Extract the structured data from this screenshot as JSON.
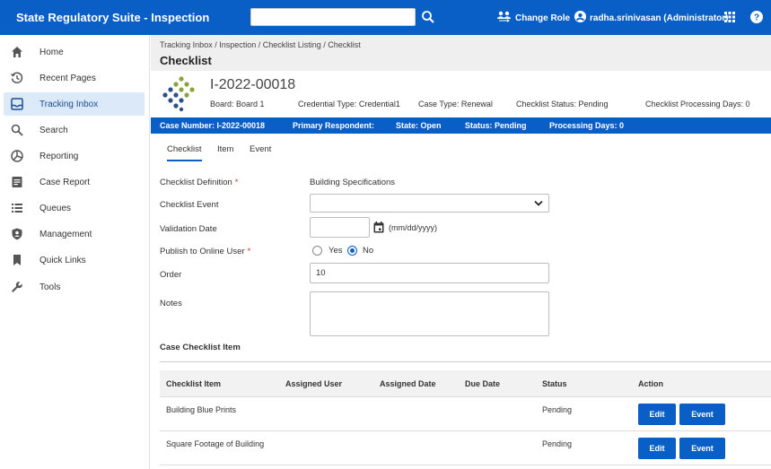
{
  "app": {
    "title": "State Regulatory Suite - Inspection"
  },
  "header": {
    "search": {
      "value": "",
      "placeholder": ""
    },
    "change_role": "Change Role",
    "user": "radha.srinivasan (Administrator)"
  },
  "sidebar": {
    "items": [
      {
        "label": "Home",
        "icon": "home-icon"
      },
      {
        "label": "Recent Pages",
        "icon": "history-icon"
      },
      {
        "label": "Tracking Inbox",
        "icon": "inbox-icon",
        "active": true
      },
      {
        "label": "Search",
        "icon": "search-icon"
      },
      {
        "label": "Reporting",
        "icon": "reporting-icon"
      },
      {
        "label": "Case Report",
        "icon": "case-report-icon"
      },
      {
        "label": "Queues",
        "icon": "queues-icon"
      },
      {
        "label": "Management",
        "icon": "management-icon"
      },
      {
        "label": "Quick Links",
        "icon": "bookmark-icon"
      },
      {
        "label": "Tools",
        "icon": "wrench-icon"
      }
    ]
  },
  "page": {
    "breadcrumb": "Tracking Inbox / Inspection / Checklist Listing / Checklist",
    "title": "Checklist"
  },
  "case": {
    "id": "I-2022-00018",
    "board": "Board:  Board 1",
    "credential_type": "Credential Type:  Credential1",
    "case_type": "Case Type:  Renewal",
    "checklist_status": "Checklist Status:  Pending",
    "processing_days": "Checklist Processing Days:  0"
  },
  "case_bar": {
    "case_number": "Case Number: I-2022-00018",
    "primary_respondent": "Primary Respondent:",
    "state": "State: Open",
    "status": "Status: Pending",
    "processing_days": "Processing Days: 0"
  },
  "tabs": [
    "Checklist",
    "Item",
    "Event"
  ],
  "form": {
    "definition_label": "Checklist Definition",
    "definition_value": "Building Specifications",
    "event_label": "Checklist Event",
    "event_value": "",
    "validation_label": "Validation Date",
    "validation_value": "",
    "date_hint": "(mm/dd/yyyy)",
    "publish_label": "Publish to Online User",
    "publish_yes": "Yes",
    "publish_no": "No",
    "publish_selected": "No",
    "order_label": "Order",
    "order_value": "10",
    "notes_label": "Notes",
    "notes_value": ""
  },
  "items_section": {
    "title": "Case Checklist Item",
    "columns": [
      "Checklist Item",
      "Assigned User",
      "Assigned Date",
      "Due Date",
      "Status",
      "Action"
    ],
    "rows": [
      {
        "item": "Building Blue Prints",
        "assigned_user": "",
        "assigned_date": "",
        "due_date": "",
        "status": "Pending"
      },
      {
        "item": "Square Footage of Building",
        "assigned_user": "",
        "assigned_date": "",
        "due_date": "",
        "status": "Pending"
      }
    ],
    "edit_label": "Edit",
    "event_label": "Event"
  },
  "colors": {
    "primary": "#0a5fc7",
    "active_nav": "#dce9f8",
    "required": "#d32f2f"
  }
}
